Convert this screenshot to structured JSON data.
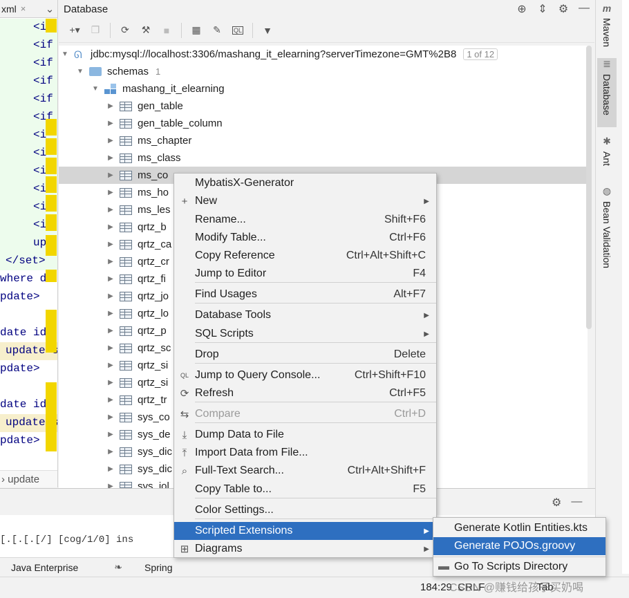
{
  "editor": {
    "tab_label": "xml",
    "tab_close": "×",
    "code_lines": [
      "<if",
      "<if",
      "<if",
      "<if",
      "<if",
      "<if",
      "<i",
      "<i",
      "<i",
      "<i",
      "<i",
      "<i",
      "upd",
      "</set>",
      "where d",
      "pdate>",
      "",
      "date id",
      "update s",
      "pdate>",
      "",
      "date id",
      "update s",
      "pdate>"
    ],
    "breadcrumb": "update"
  },
  "db_panel": {
    "title": "Database",
    "connection": "jdbc:mysql://localhost:3306/mashang_it_elearning?serverTimezone=GMT%2B8",
    "connection_badge": "1 of 12",
    "schemas_label": "schemas",
    "schemas_count": "1",
    "schema_name": "mashang_it_elearning",
    "tables": [
      "gen_table",
      "gen_table_column",
      "ms_chapter",
      "ms_class",
      "ms_co",
      "ms_ho",
      "ms_les",
      "qrtz_b",
      "qrtz_ca",
      "qrtz_cr",
      "qrtz_fi",
      "qrtz_jo",
      "qrtz_lo",
      "qrtz_p",
      "qrtz_sc",
      "qrtz_si",
      "qrtz_si",
      "qrtz_tr",
      "sys_co",
      "sys_de",
      "sys_dic",
      "sys_dic",
      "sys_jol"
    ]
  },
  "context_menu": {
    "items": [
      {
        "label": "MybatisX-Generator",
        "icon": "",
        "shortcut": "",
        "submenu": false
      },
      {
        "label": "New",
        "icon": "+",
        "shortcut": "",
        "submenu": true
      },
      {
        "label": "Rename...",
        "icon": "",
        "shortcut": "Shift+F6",
        "submenu": false
      },
      {
        "label": "Modify Table...",
        "icon": "",
        "shortcut": "Ctrl+F6",
        "submenu": false
      },
      {
        "label": "Copy Reference",
        "icon": "",
        "shortcut": "Ctrl+Alt+Shift+C",
        "submenu": false
      },
      {
        "label": "Jump to Editor",
        "icon": "",
        "shortcut": "F4",
        "submenu": false
      },
      {
        "label": "Find Usages",
        "icon": "",
        "shortcut": "Alt+F7",
        "submenu": false
      },
      {
        "label": "Database Tools",
        "icon": "",
        "shortcut": "",
        "submenu": true
      },
      {
        "label": "SQL Scripts",
        "icon": "",
        "shortcut": "",
        "submenu": true
      },
      {
        "label": "Drop",
        "icon": "",
        "shortcut": "Delete",
        "submenu": false
      },
      {
        "label": "Jump to Query Console...",
        "icon": "QL",
        "shortcut": "Ctrl+Shift+F10",
        "submenu": false
      },
      {
        "label": "Refresh",
        "icon": "⟳",
        "shortcut": "Ctrl+F5",
        "submenu": false
      },
      {
        "label": "Compare",
        "icon": "⇆",
        "shortcut": "Ctrl+D",
        "submenu": false
      },
      {
        "label": "Dump Data to File",
        "icon": "⤓",
        "shortcut": "",
        "submenu": false
      },
      {
        "label": "Import Data from File...",
        "icon": "⤒",
        "shortcut": "",
        "submenu": false
      },
      {
        "label": "Full-Text Search...",
        "icon": "⌕",
        "shortcut": "Ctrl+Alt+Shift+F",
        "submenu": false
      },
      {
        "label": "Copy Table to...",
        "icon": "",
        "shortcut": "F5",
        "submenu": false
      },
      {
        "label": "Color Settings...",
        "icon": "",
        "shortcut": "",
        "submenu": false
      },
      {
        "label": "Scripted Extensions",
        "icon": "",
        "shortcut": "",
        "submenu": true
      },
      {
        "label": "Diagrams",
        "icon": "⊞",
        "shortcut": "",
        "submenu": true
      }
    ]
  },
  "submenu": {
    "items": [
      {
        "label": "Generate Kotlin Entities.kts"
      },
      {
        "label": "Generate POJOs.groovy"
      },
      {
        "label": "Go To Scripts Directory"
      }
    ]
  },
  "right_bar": {
    "maven": "Maven",
    "database": "Database",
    "ant": "Ant",
    "bean_validation": "Bean Validation"
  },
  "bottom": {
    "log_text": "[.[.[.[/]    [cog/1/0]   ins"
  },
  "toolstrip": {
    "java_enterprise": "Java Enterprise",
    "spring": "Spring"
  },
  "status": {
    "position": "184:29",
    "line_sep": "CRLF",
    "indent": "Tab"
  },
  "watermark": "CSDN @赚钱给孩子买奶喝",
  "colors": {
    "highlight": "#2e6fc0",
    "selection_row": "#d5d5d5",
    "gutter_mark": "#f2d600"
  }
}
